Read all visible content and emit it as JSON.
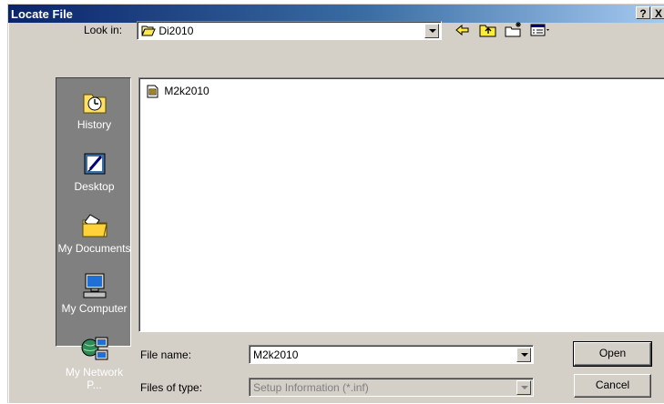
{
  "window": {
    "title": "Locate File",
    "help_label": "?",
    "close_label": "X"
  },
  "lookin": {
    "label": "Look in:",
    "value": "Di2010"
  },
  "places": [
    {
      "label": "History",
      "icon": "history-icon"
    },
    {
      "label": "Desktop",
      "icon": "desktop-icon"
    },
    {
      "label": "My Documents",
      "icon": "my-documents-icon"
    },
    {
      "label": "My Computer",
      "icon": "my-computer-icon"
    },
    {
      "label": "My Network P...",
      "icon": "my-network-places-icon"
    }
  ],
  "files": [
    {
      "name": "M2k2010",
      "icon": "setup-info-file-icon"
    }
  ],
  "filename": {
    "label": "File name:",
    "value": "M2k2010"
  },
  "filetype": {
    "label": "Files of type:",
    "value": "Setup Information (*.inf)"
  },
  "buttons": {
    "open": "Open",
    "cancel": "Cancel"
  }
}
